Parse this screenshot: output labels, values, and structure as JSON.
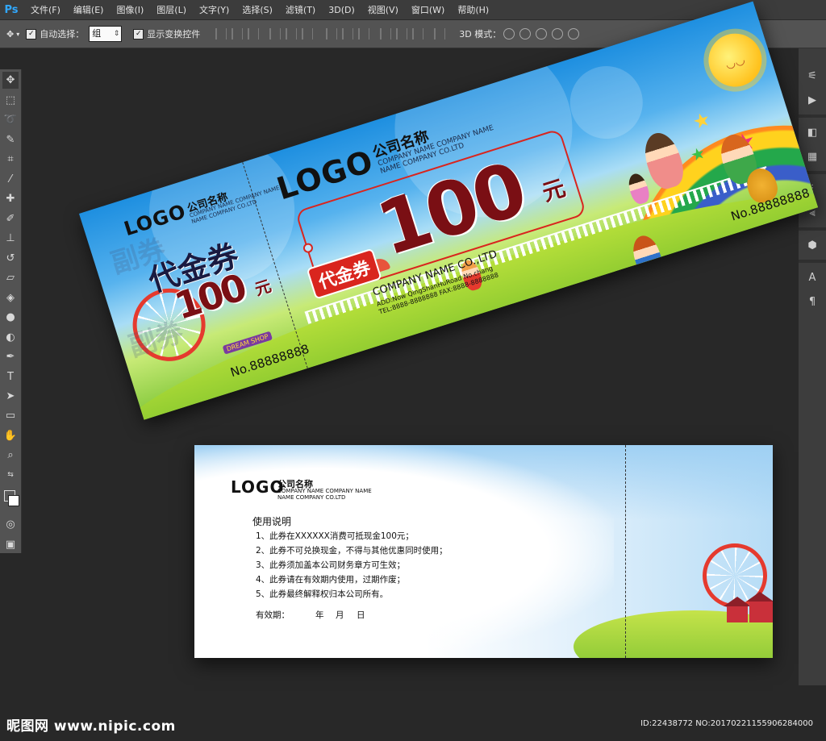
{
  "app": {
    "logo_text": "Ps"
  },
  "menu": {
    "items": [
      "文件(F)",
      "编辑(E)",
      "图像(I)",
      "图层(L)",
      "文字(Y)",
      "选择(S)",
      "滤镜(T)",
      "3D(D)",
      "视图(V)",
      "窗口(W)",
      "帮助(H)"
    ]
  },
  "options": {
    "auto_select_label": "自动选择：",
    "auto_select_value": "组",
    "show_transform_label": "显示变换控件",
    "mode_3d_label": "3D 模式："
  },
  "colors": {
    "ps_blue": "#31a8ff",
    "ticket_red": "#d9251e",
    "amount_red": "#7a0f14"
  },
  "front": {
    "stub": {
      "logo": "LOGO",
      "company_cn": "公司名称",
      "company_en_lines": [
        "COMPANY NAME COMPANY NAME",
        "NAME COMPANY CO.LTD"
      ],
      "voucher": "代金券",
      "amount": "100",
      "currency": "元",
      "serial": "No.88888888",
      "watermark": "副券",
      "sign": "DREAM SHOP"
    },
    "main": {
      "logo": "LOGO",
      "company_cn": "公司名称",
      "company_en_lines": [
        "COMPANY NAME COMPANY NAME",
        "NAME COMPANY CO.LTD"
      ],
      "badge": "代金券",
      "amount": "100",
      "currency": "元",
      "company_footer": "COMPANY NAME CO.,LTD",
      "address_lines": [
        "ADD:Now QingShanHuRoad No.chang",
        "TEL:8888-8888888  FAX:8888-8888888"
      ],
      "serial": "No.88888888"
    }
  },
  "back": {
    "logo": "LOGO",
    "company_cn": "公司名称",
    "company_en_lines": [
      "COMPANY NAME COMPANY NAME",
      "NAME COMPANY CO.LTD"
    ],
    "rules_title": "使用说明",
    "rules": [
      "1、此券在XXXXXX消费可抵现金100元；",
      "2、此券不可兑换现金，不得与其他优惠同时使用；",
      "3、此券须加盖本公司财务章方可生效；",
      "4、此券请在有效期内使用，过期作废；",
      "5、此券最终解释权归本公司所有。"
    ],
    "validity_label": "有效期：",
    "validity_units": [
      "年",
      "月",
      "日"
    ]
  },
  "footer": {
    "site": "昵图网 www.nipic.com",
    "id_line": "ID:22438772 NO:20170221155906284000"
  }
}
